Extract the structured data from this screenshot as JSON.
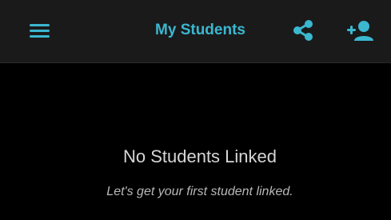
{
  "app": {
    "accent_color": "#3bb7d0",
    "background_color": "#000000",
    "header_color": "#1a1a1a"
  },
  "header": {
    "title": "My Students",
    "menu_icon": "hamburger-menu-icon",
    "share_icon": "share-icon",
    "add_icon": "add-student-icon"
  },
  "empty_state": {
    "title": "No Students Linked",
    "subtitle": "Let's get your first student linked."
  }
}
